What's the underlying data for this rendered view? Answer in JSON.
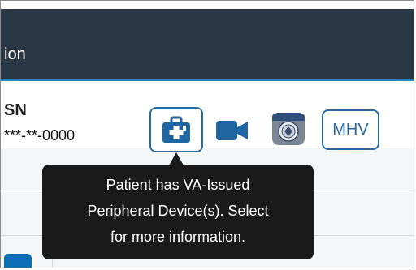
{
  "header": {
    "title_fragment": "ion"
  },
  "patient": {
    "ssn_label": "SN",
    "ssn_value": "***-**-0000"
  },
  "toolbar": {
    "device_button_icon": "medical-kit-icon",
    "video_button_icon": "video-camera-icon",
    "vvc_button_icon": "va-seal-app-icon",
    "mhv_label": "MHV"
  },
  "tooltip": {
    "line1": "Patient has VA-Issued",
    "line2": "Peripheral Device(s). Select",
    "line3": "for more information."
  },
  "colors": {
    "header_bg": "#2a3846",
    "accent_blue": "#2b6aa0",
    "tooltip_bg": "#1a1a1a",
    "tab_blue": "#0b6fb5"
  }
}
